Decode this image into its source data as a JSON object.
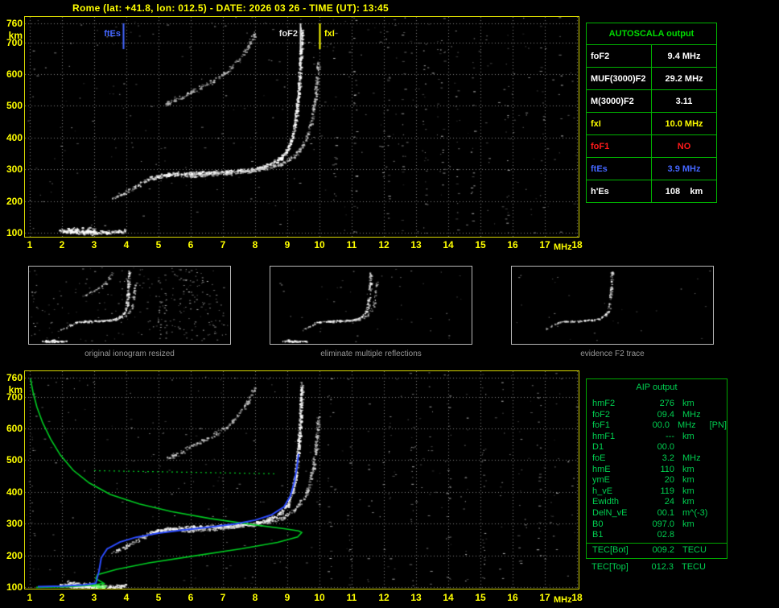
{
  "app": {
    "title": "Rome (lat: +41.8, lon: 012.5) - DATE: 2026 03 26 - TIME (UT): 13:45"
  },
  "colors": {
    "axis_yellow": "#ffff00",
    "plot_border_yellow": "#d6d600",
    "grid_white": "#ebebeb",
    "table_green": "#00b400",
    "aip_text_green": "#00cf50",
    "profile_green": "#00cc22",
    "restored_blue": "#2b4bff",
    "ftEs_blue": "#4466ff",
    "fxI_yellow": "#ffff00",
    "foF1_red": "#ff1a1a"
  },
  "autoscala_table": {
    "header": "AUTOSCALA output",
    "rows": [
      {
        "param": "foF2",
        "value": "9.4 MHz",
        "color": "#ffffff"
      },
      {
        "param": "MUF(3000)F2",
        "value": "29.2 MHz",
        "color": "#ffffff"
      },
      {
        "param": "M(3000)F2",
        "value": "3.11",
        "color": "#ffffff"
      },
      {
        "param": "fxI",
        "value": "10.0 MHz",
        "color": "#ffff00"
      },
      {
        "param": "foF1",
        "value": "NO",
        "color": "#ff1a1a"
      },
      {
        "param": "ftEs",
        "value": "3.9 MHz",
        "color": "#4466ff"
      },
      {
        "param": "h'Es",
        "value": "108    km",
        "color": "#ffffff"
      }
    ]
  },
  "thumbnails": [
    {
      "caption": "original ionogram resized",
      "mode": "full"
    },
    {
      "caption": "eliminate multiple reflections",
      "mode": "clean"
    },
    {
      "caption": "evidence F2 trace",
      "mode": "f2only"
    }
  ],
  "aip_table": {
    "header": "AIP output",
    "rows": [
      {
        "param": "hmF2",
        "value": "276",
        "unit": "km",
        "note": ""
      },
      {
        "param": "foF2",
        "value": "09.4",
        "unit": "MHz",
        "note": ""
      },
      {
        "param": "foF1",
        "value": "00.0",
        "unit": "MHz",
        "note": "[PN]"
      },
      {
        "param": "hmF1",
        "value": "---",
        "unit": "km",
        "note": ""
      },
      {
        "param": "D1",
        "value": "00.0",
        "unit": "",
        "note": ""
      },
      {
        "param": "foE",
        "value": "3.2",
        "unit": "MHz",
        "note": ""
      },
      {
        "param": "hmE",
        "value": "110",
        "unit": "km",
        "note": ""
      },
      {
        "param": "ymE",
        "value": "20",
        "unit": "km",
        "note": ""
      },
      {
        "param": "h_vE",
        "value": "119",
        "unit": "km",
        "note": ""
      },
      {
        "param": "Ewidth",
        "value": "24",
        "unit": "km",
        "note": ""
      },
      {
        "param": "DelN_vE",
        "value": "00.1",
        "unit": "m^(-3)",
        "note": ""
      },
      {
        "param": "B0",
        "value": "097.0",
        "unit": "km",
        "note": ""
      },
      {
        "param": "B1",
        "value": "02.8",
        "unit": "",
        "note": ""
      },
      {
        "param": "TEC[Bot]",
        "value": "009.2",
        "unit": "TECU",
        "note": "",
        "divider": true
      }
    ],
    "footer": {
      "param": "TEC[Top]",
      "value": "012.3",
      "unit": "TECU"
    }
  },
  "chart_data": [
    {
      "id": "ionogram-top",
      "type": "scatter",
      "title": "ionogram with autoscaled characteristics",
      "xlabel": "MHz",
      "ylabel": "km",
      "xlim": [
        1,
        18
      ],
      "ylim": [
        100,
        760
      ],
      "x_ticks": [
        1,
        2,
        3,
        4,
        5,
        6,
        7,
        8,
        9,
        10,
        11,
        12,
        13,
        14,
        15,
        16,
        17,
        18
      ],
      "y_ticks": [
        760,
        700,
        600,
        500,
        400,
        300,
        200,
        100
      ],
      "grid": true,
      "seed": 7,
      "noise_count": 280,
      "markers": [
        {
          "label": "ftEs",
          "freq": 3.9,
          "color": "#4466ff",
          "side": "left"
        },
        {
          "label": "foF2",
          "freq": 9.4,
          "color": "#e0e0e0",
          "side": "left"
        },
        {
          "label": "fxI",
          "freq": 10.0,
          "color": "#ffff00",
          "side": "right"
        }
      ],
      "rfi_columns": [
        1.12,
        10.45,
        11.1,
        12.1,
        12.6,
        13.25,
        13.8,
        14.25,
        14.75,
        15.2,
        15.8,
        16.35,
        16.9,
        17.45
      ],
      "traces": [
        {
          "name": "Es",
          "color": "#ffffff",
          "width": 7,
          "density": 2.4,
          "points": [
            [
              1.9,
              108
            ],
            [
              2.4,
              104
            ],
            [
              3.0,
              102
            ],
            [
              3.6,
              103
            ],
            [
              3.95,
              106
            ]
          ]
        },
        {
          "name": "Es-blob",
          "color": "#ffffff",
          "width": 14,
          "density": 2.2,
          "points": [
            [
              2.15,
              112
            ],
            [
              2.6,
              108
            ],
            [
              3.05,
              105
            ]
          ]
        },
        {
          "name": "F-leading",
          "color": "#e8e8e8",
          "width": 9,
          "density": 1.1,
          "points": [
            [
              3.55,
              210
            ],
            [
              3.95,
              228
            ],
            [
              4.35,
              252
            ],
            [
              4.7,
              270
            ]
          ]
        },
        {
          "name": "F2-O",
          "color": "#ffffff",
          "width": 7,
          "density": 2.1,
          "points": [
            [
              4.7,
              272
            ],
            [
              5.2,
              283
            ],
            [
              5.8,
              288
            ],
            [
              6.5,
              290
            ],
            [
              7.2,
              293
            ],
            [
              7.8,
              299
            ],
            [
              8.3,
              310
            ],
            [
              8.7,
              330
            ],
            [
              9.0,
              362
            ],
            [
              9.15,
              405
            ],
            [
              9.25,
              460
            ],
            [
              9.33,
              540
            ],
            [
              9.4,
              650
            ],
            [
              9.43,
              745
            ]
          ]
        },
        {
          "name": "F2-X",
          "color": "#d0d0d0",
          "width": 6,
          "density": 1.2,
          "points": [
            [
              5.7,
              278
            ],
            [
              6.4,
              283
            ],
            [
              7.1,
              288
            ],
            [
              7.8,
              295
            ],
            [
              8.35,
              305
            ],
            [
              8.85,
              320
            ],
            [
              9.25,
              348
            ],
            [
              9.55,
              390
            ],
            [
              9.72,
              445
            ],
            [
              9.85,
              525
            ],
            [
              9.95,
              640
            ]
          ]
        },
        {
          "name": "F2-second-hop",
          "color": "#c8c8c8",
          "width": 9,
          "density": 1.0,
          "points": [
            [
              5.2,
              505
            ],
            [
              5.7,
              528
            ],
            [
              6.2,
              555
            ],
            [
              6.7,
              580
            ],
            [
              7.1,
              608
            ],
            [
              7.5,
              648
            ],
            [
              7.8,
              695
            ],
            [
              8.0,
              735
            ]
          ]
        }
      ]
    },
    {
      "id": "ionogram-bottom",
      "type": "scatter",
      "title": "ionogram with restored trace and electron density profile",
      "xlabel": "MHz",
      "ylabel": "km",
      "xlim": [
        1,
        18
      ],
      "ylim": [
        100,
        760
      ],
      "x_ticks": [
        1,
        2,
        3,
        4,
        5,
        6,
        7,
        8,
        9,
        10,
        11,
        12,
        13,
        14,
        15,
        16,
        17,
        18
      ],
      "y_ticks": [
        760,
        700,
        600,
        500,
        400,
        300,
        200,
        100
      ],
      "grid": true,
      "seed": 13,
      "noise_count": 240,
      "rfi_columns": [
        1.12,
        10.3,
        10.9,
        11.55,
        12.2,
        12.85,
        13.4,
        14.0,
        14.55,
        15.1,
        15.65,
        16.2,
        16.8,
        17.35
      ],
      "traces": [
        {
          "name": "Es",
          "color": "#ffffff",
          "width": 7,
          "density": 2.4,
          "points": [
            [
              1.9,
              108
            ],
            [
              2.4,
              104
            ],
            [
              3.0,
              102
            ],
            [
              3.6,
              103
            ],
            [
              3.95,
              106
            ]
          ]
        },
        {
          "name": "Es-blob",
          "color": "#ffffff",
          "width": 14,
          "density": 2.2,
          "points": [
            [
              2.15,
              112
            ],
            [
              2.6,
              108
            ],
            [
              3.05,
              105
            ]
          ]
        },
        {
          "name": "Es-bright",
          "color": "#6aff6a",
          "width": 9,
          "density": 2.4,
          "points": [
            [
              2.85,
              107
            ],
            [
              3.35,
              103
            ]
          ]
        },
        {
          "name": "F-leading",
          "color": "#e8e8e8",
          "width": 9,
          "density": 1.1,
          "points": [
            [
              3.55,
              210
            ],
            [
              3.95,
              228
            ],
            [
              4.35,
              252
            ],
            [
              4.7,
              270
            ]
          ]
        },
        {
          "name": "F2-O",
          "color": "#ffffff",
          "width": 7,
          "density": 2.1,
          "points": [
            [
              4.7,
              272
            ],
            [
              5.2,
              283
            ],
            [
              5.8,
              288
            ],
            [
              6.5,
              290
            ],
            [
              7.2,
              293
            ],
            [
              7.8,
              299
            ],
            [
              8.3,
              310
            ],
            [
              8.7,
              330
            ],
            [
              9.0,
              362
            ],
            [
              9.15,
              405
            ],
            [
              9.25,
              460
            ],
            [
              9.33,
              540
            ],
            [
              9.4,
              650
            ],
            [
              9.43,
              745
            ]
          ]
        },
        {
          "name": "F2-X",
          "color": "#d0d0d0",
          "width": 6,
          "density": 1.2,
          "points": [
            [
              5.7,
              278
            ],
            [
              6.4,
              283
            ],
            [
              7.1,
              288
            ],
            [
              7.8,
              295
            ],
            [
              8.35,
              305
            ],
            [
              8.85,
              320
            ],
            [
              9.25,
              348
            ],
            [
              9.55,
              390
            ],
            [
              9.72,
              445
            ],
            [
              9.85,
              525
            ],
            [
              9.95,
              640
            ]
          ]
        },
        {
          "name": "F2-second-hop",
          "color": "#c8c8c8",
          "width": 9,
          "density": 1.0,
          "points": [
            [
              5.2,
              505
            ],
            [
              5.7,
              528
            ],
            [
              6.2,
              555
            ],
            [
              6.7,
              580
            ],
            [
              7.1,
              608
            ],
            [
              7.5,
              648
            ],
            [
              7.8,
              695
            ],
            [
              8.0,
              735
            ]
          ]
        }
      ],
      "profile": {
        "name": "electron-density-profile",
        "color": "#00cc22",
        "points": [
          [
            1.02,
            758
          ],
          [
            1.1,
            715
          ],
          [
            1.22,
            668
          ],
          [
            1.4,
            618
          ],
          [
            1.65,
            566
          ],
          [
            1.95,
            516
          ],
          [
            2.35,
            468
          ],
          [
            2.85,
            428
          ],
          [
            3.5,
            392
          ],
          [
            4.4,
            362
          ],
          [
            5.4,
            338
          ],
          [
            6.6,
            316
          ],
          [
            7.9,
            297
          ],
          [
            8.9,
            284
          ],
          [
            9.35,
            277
          ],
          [
            9.45,
            272
          ],
          [
            9.32,
            258
          ],
          [
            8.7,
            241
          ],
          [
            7.6,
            221
          ],
          [
            6.1,
            198
          ],
          [
            4.7,
            176
          ],
          [
            3.7,
            156
          ],
          [
            3.1,
            139
          ],
          [
            3.05,
            127
          ],
          [
            3.3,
            112
          ],
          [
            2.9,
            105
          ],
          [
            2.1,
            101
          ],
          [
            1.2,
            99
          ]
        ]
      },
      "profile_dotted": {
        "name": "profile-dotted-segment",
        "color": "#00cc22",
        "points": [
          [
            3.0,
            467
          ],
          [
            8.7,
            457
          ]
        ]
      },
      "restored": {
        "name": "restored-trace",
        "color": "#2b4bff",
        "points": [
          [
            1.25,
            101
          ],
          [
            2.0,
            103
          ],
          [
            2.7,
            107
          ],
          [
            3.05,
            112
          ],
          [
            3.15,
            150
          ],
          [
            3.22,
            192
          ],
          [
            3.4,
            220
          ],
          [
            3.8,
            242
          ],
          [
            4.3,
            257
          ],
          [
            5.0,
            270
          ],
          [
            5.8,
            280
          ],
          [
            6.6,
            289
          ],
          [
            7.4,
            299
          ],
          [
            8.0,
            311
          ],
          [
            8.5,
            327
          ],
          [
            8.9,
            353
          ],
          [
            9.1,
            388
          ],
          [
            9.22,
            432
          ],
          [
            9.3,
            478
          ],
          [
            9.35,
            520
          ]
        ]
      }
    }
  ]
}
